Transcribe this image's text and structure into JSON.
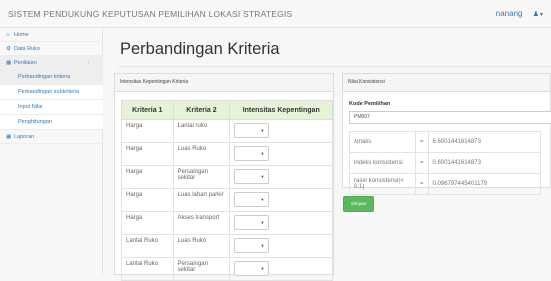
{
  "app": {
    "title": "SISTEM PENDUKUNG KEPUTUSAN PEMILIHAN LOKASI STRATEGIS",
    "user": "nanang"
  },
  "sidebar": {
    "items": [
      {
        "label": "Home",
        "icon": "home-icon"
      },
      {
        "label": "Data Ruko",
        "icon": "gear-icon"
      },
      {
        "label": "Penilaian",
        "icon": "grid-icon"
      },
      {
        "label": "Laporan",
        "icon": "grid-icon"
      }
    ],
    "subitems": [
      "Perbandingan kriteria",
      "Perbandingan subkriteria",
      "Input Nilai",
      "Penghitungan"
    ]
  },
  "page": {
    "title": "Perbandingan Kriteria"
  },
  "left_panel": {
    "heading": "Intensitas Kepentingan Kriteria",
    "columns": [
      "Kriteria 1",
      "Kriteria 2",
      "Intensitas Kepentingan"
    ],
    "rows": [
      {
        "k1": "Harga",
        "k2": "Lantai ruko"
      },
      {
        "k1": "Harga",
        "k2": "Luas Ruko"
      },
      {
        "k1": "Harga",
        "k2": "Persaingan sekitar"
      },
      {
        "k1": "Harga",
        "k2": "Luas lahan parkir"
      },
      {
        "k1": "Harga",
        "k2": "Akses transport"
      },
      {
        "k1": "Lantai Ruko",
        "k2": "Luas Ruko"
      },
      {
        "k1": "Lantai Ruko",
        "k2": "Persaingan sekitar"
      }
    ]
  },
  "right_panel": {
    "heading": "Nilai Konsistensi",
    "kode_label": "Kode Pemilihan",
    "kode_value": "PM007",
    "rows": [
      {
        "label": "λmaks",
        "eq": "=",
        "value": "6.6001441614873"
      },
      {
        "label": "indeks konsistensi",
        "eq": "=",
        "value": "0.6001441614873"
      },
      {
        "label": "rasio konsistensi(< 0.1)",
        "eq": "=",
        "value": "0.096797445401179"
      }
    ],
    "save_label": "Simpan"
  },
  "colors": {
    "accent": "#337ab7",
    "header_bg": "#e6f3d7",
    "save": "#5cb85c"
  }
}
